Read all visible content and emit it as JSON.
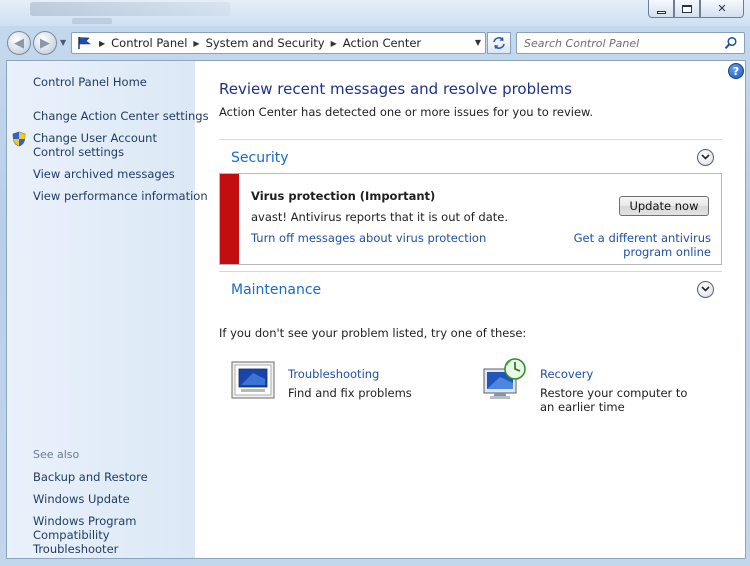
{
  "window": {
    "minimize_label": "",
    "maximize_label": "",
    "close_label": "✕"
  },
  "navigation": {
    "breadcrumbs": [
      "Control Panel",
      "System and Security",
      "Action Center"
    ],
    "search_placeholder": "Search Control Panel"
  },
  "sidebar": {
    "home": "Control Panel Home",
    "links": [
      "Change Action Center settings",
      "Change User Account Control settings",
      "View archived messages",
      "View performance information"
    ],
    "see_also_heading": "See also",
    "see_also": [
      "Backup and Restore",
      "Windows Update",
      "Windows Program Compatibility Troubleshooter"
    ]
  },
  "main": {
    "title": "Review recent messages and resolve problems",
    "subtitle": "Action Center has detected one or more issues for you to review.",
    "security": {
      "heading": "Security",
      "alert": {
        "title": "Virus protection  (Important)",
        "description": "avast! Antivirus reports that it is out of date.",
        "button": "Update now",
        "link_left": "Turn off messages about virus protection",
        "link_right": "Get a different antivirus program online",
        "severity_color": "#c20e0e"
      }
    },
    "maintenance": {
      "heading": "Maintenance"
    },
    "try_text": "If you don't see your problem listed, try one of these:",
    "tools": [
      {
        "name": "Troubleshooting",
        "description": "Find and fix problems",
        "icon": "troubleshooting-icon"
      },
      {
        "name": "Recovery",
        "description": "Restore your computer to an earlier time",
        "icon": "recovery-icon"
      }
    ]
  },
  "colors": {
    "link": "#1e50a2",
    "section_heading": "#1a6bc4",
    "title": "#1e3287",
    "alert_bar": "#c20e0e"
  }
}
